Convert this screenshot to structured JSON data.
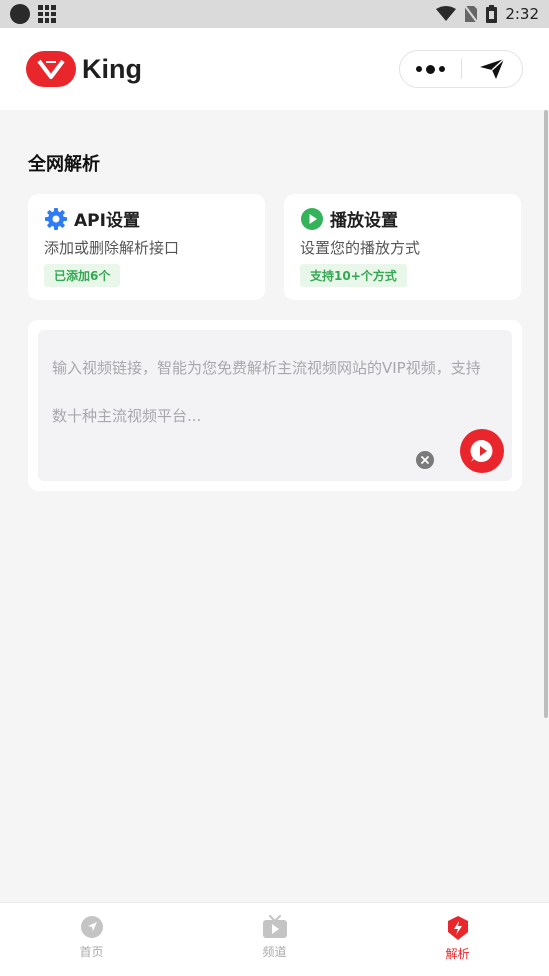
{
  "status_bar": {
    "time": "2:32"
  },
  "header": {
    "app_name": "King"
  },
  "main": {
    "section_title": "全网解析",
    "cards": [
      {
        "title": "API设置",
        "desc": "添加或删除解析接口",
        "badge": "已添加6个",
        "icon": "gear-icon"
      },
      {
        "title": "播放设置",
        "desc": "设置您的播放方式",
        "badge": "支持10+个方式",
        "icon": "play-icon"
      }
    ],
    "input": {
      "placeholder": "输入视频链接，智能为您免费解析主流视频网站的VIP视频，支持数十种主流视频平台..."
    }
  },
  "bottom_nav": {
    "items": [
      {
        "label": "首页",
        "icon": "compass-icon",
        "active": false
      },
      {
        "label": "频道",
        "icon": "tv-icon",
        "active": false
      },
      {
        "label": "解析",
        "icon": "bolt-shield-icon",
        "active": true
      }
    ]
  },
  "colors": {
    "accent": "#e8262b",
    "badge_green": "#34a853",
    "api_blue": "#2f7cf6"
  }
}
